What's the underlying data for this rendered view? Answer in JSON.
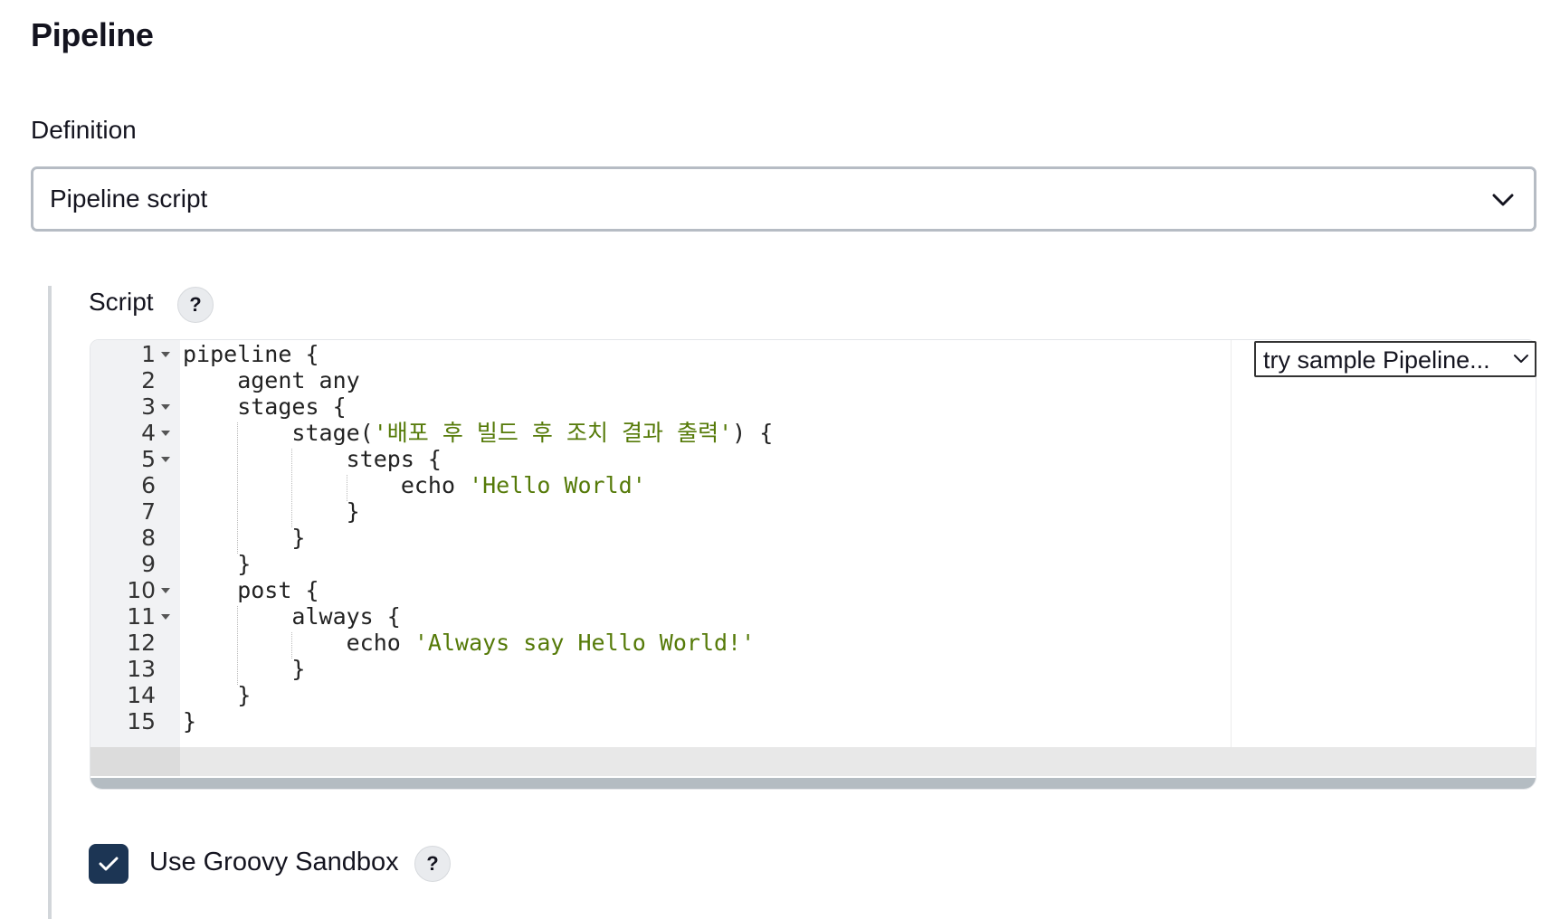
{
  "page": {
    "title": "Pipeline"
  },
  "definition": {
    "label": "Definition",
    "selected": "Pipeline script",
    "icon": "chevron-down-icon"
  },
  "script": {
    "label": "Script",
    "help": "?",
    "sample_select": "try sample Pipeline...",
    "lines": [
      {
        "n": "1",
        "parts": [
          {
            "t": "pipeline "
          },
          {
            "t": "{"
          }
        ]
      },
      {
        "n": "2",
        "parts": [
          {
            "t": "    agent any"
          }
        ]
      },
      {
        "n": "3",
        "parts": [
          {
            "t": "    stages {"
          }
        ]
      },
      {
        "n": "4",
        "parts": [
          {
            "t": "        stage("
          },
          {
            "t": "'배포 후 빌드 후 조치 결과 출력'",
            "s": true
          },
          {
            "t": ") {"
          }
        ]
      },
      {
        "n": "5",
        "parts": [
          {
            "t": "            steps {"
          }
        ]
      },
      {
        "n": "6",
        "parts": [
          {
            "t": "                echo "
          },
          {
            "t": "'Hello World'",
            "s": true
          }
        ]
      },
      {
        "n": "7",
        "parts": [
          {
            "t": "            }"
          }
        ]
      },
      {
        "n": "8",
        "parts": [
          {
            "t": "        }"
          }
        ]
      },
      {
        "n": "9",
        "parts": [
          {
            "t": "    }"
          }
        ]
      },
      {
        "n": "10",
        "parts": [
          {
            "t": "    post {"
          }
        ]
      },
      {
        "n": "11",
        "parts": [
          {
            "t": "        always {"
          }
        ]
      },
      {
        "n": "12",
        "parts": [
          {
            "t": "            echo "
          },
          {
            "t": "'Always say Hello World!'",
            "s": true
          }
        ]
      },
      {
        "n": "13",
        "parts": [
          {
            "t": "        }"
          }
        ]
      },
      {
        "n": "14",
        "parts": [
          {
            "t": "    }"
          }
        ]
      },
      {
        "n": "15",
        "parts": [
          {
            "t": "}"
          }
        ]
      }
    ],
    "fold_lines": [
      "1",
      "3",
      "4",
      "5",
      "10",
      "11"
    ],
    "active_line": "15",
    "string_color": "#557a08"
  },
  "sandbox": {
    "label": "Use Groovy Sandbox",
    "checked": true,
    "help": "?",
    "checkbox_color": "#1c3554"
  }
}
